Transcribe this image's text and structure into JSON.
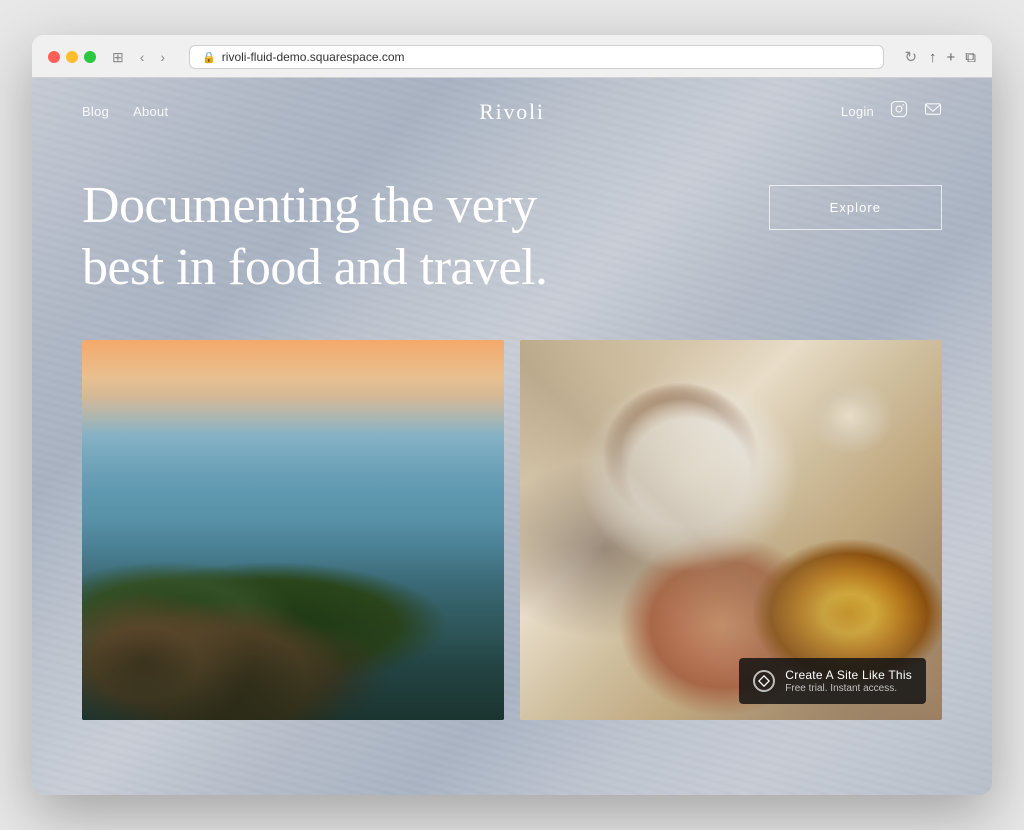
{
  "browser": {
    "url": "rivoli-fluid-demo.squarespace.com",
    "controls": {
      "back": "‹",
      "forward": "›",
      "sidebar": "⊞",
      "reload": "↻",
      "share": "↑",
      "new_tab": "+",
      "duplicate": "⧉"
    }
  },
  "nav": {
    "left_links": [
      {
        "label": "Blog"
      },
      {
        "label": "About"
      }
    ],
    "logo": "Rivoli",
    "right": {
      "login_label": "Login",
      "instagram_icon": "instagram-icon",
      "mail_icon": "mail-icon"
    }
  },
  "hero": {
    "title": "Documenting the very best in food and travel.",
    "explore_button": "Explore"
  },
  "images": {
    "coastal": {
      "alt": "Coastal landscape at sunset"
    },
    "coffee": {
      "alt": "Coffee and croissant from above"
    }
  },
  "badge": {
    "title": "Create A Site Like This",
    "subtitle": "Free trial. Instant access.",
    "icon": "squarespace-icon"
  },
  "colors": {
    "background": "#b8bec8",
    "nav_text": "#ffffff",
    "hero_text": "#ffffff",
    "explore_border": "rgba(255,255,255,0.7)",
    "badge_bg": "rgba(20,20,20,0.85)"
  }
}
